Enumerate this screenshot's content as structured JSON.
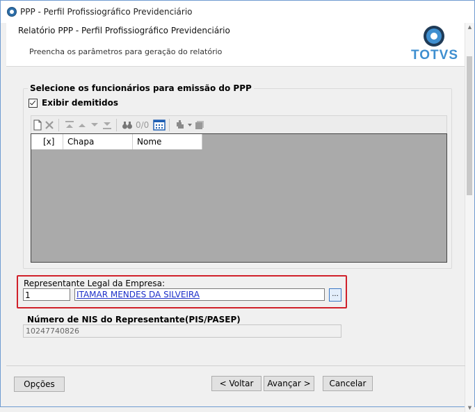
{
  "window": {
    "title": "PPP - Perfil Profissiográfico Previdenciário"
  },
  "header": {
    "title": "Relatório PPP - Perfil Profissiográfico Previdenciário",
    "subtitle": "Preencha os parâmetros para geração do relatório",
    "logo_text": "TOTVS"
  },
  "employees": {
    "group_title": "Selecione os funcionários para emissão do PPP",
    "show_dismissed_label": "Exibir demitidos",
    "show_dismissed_checked": true,
    "toolbar": {
      "icons": [
        "new-icon",
        "delete-icon",
        "move-first-icon",
        "move-up-icon",
        "move-down-icon",
        "move-last-icon",
        "binoculars-icon",
        "grid-select-icon",
        "tools-icon",
        "tools-dropdown-icon",
        "export-icon"
      ],
      "counter": "0/0"
    },
    "grid": {
      "columns": [
        "[x]",
        "Chapa",
        "Nome"
      ]
    }
  },
  "representative": {
    "label": "Representante Legal da Empresa:",
    "code": "1",
    "name": "ITAMAR MENDES DA SILVEIRA",
    "lookup_label": "..."
  },
  "nis": {
    "label": "Número de NIS do Representante(PIS/PASEP)",
    "value": "10247740826"
  },
  "footer": {
    "options_label": "Opções",
    "back_label": "< Voltar",
    "next_label": "Avançar >",
    "cancel_label": "Cancelar"
  },
  "colors": {
    "accent": "#3f8fd0",
    "highlight": "#d0202a",
    "link": "#1d30c9"
  }
}
